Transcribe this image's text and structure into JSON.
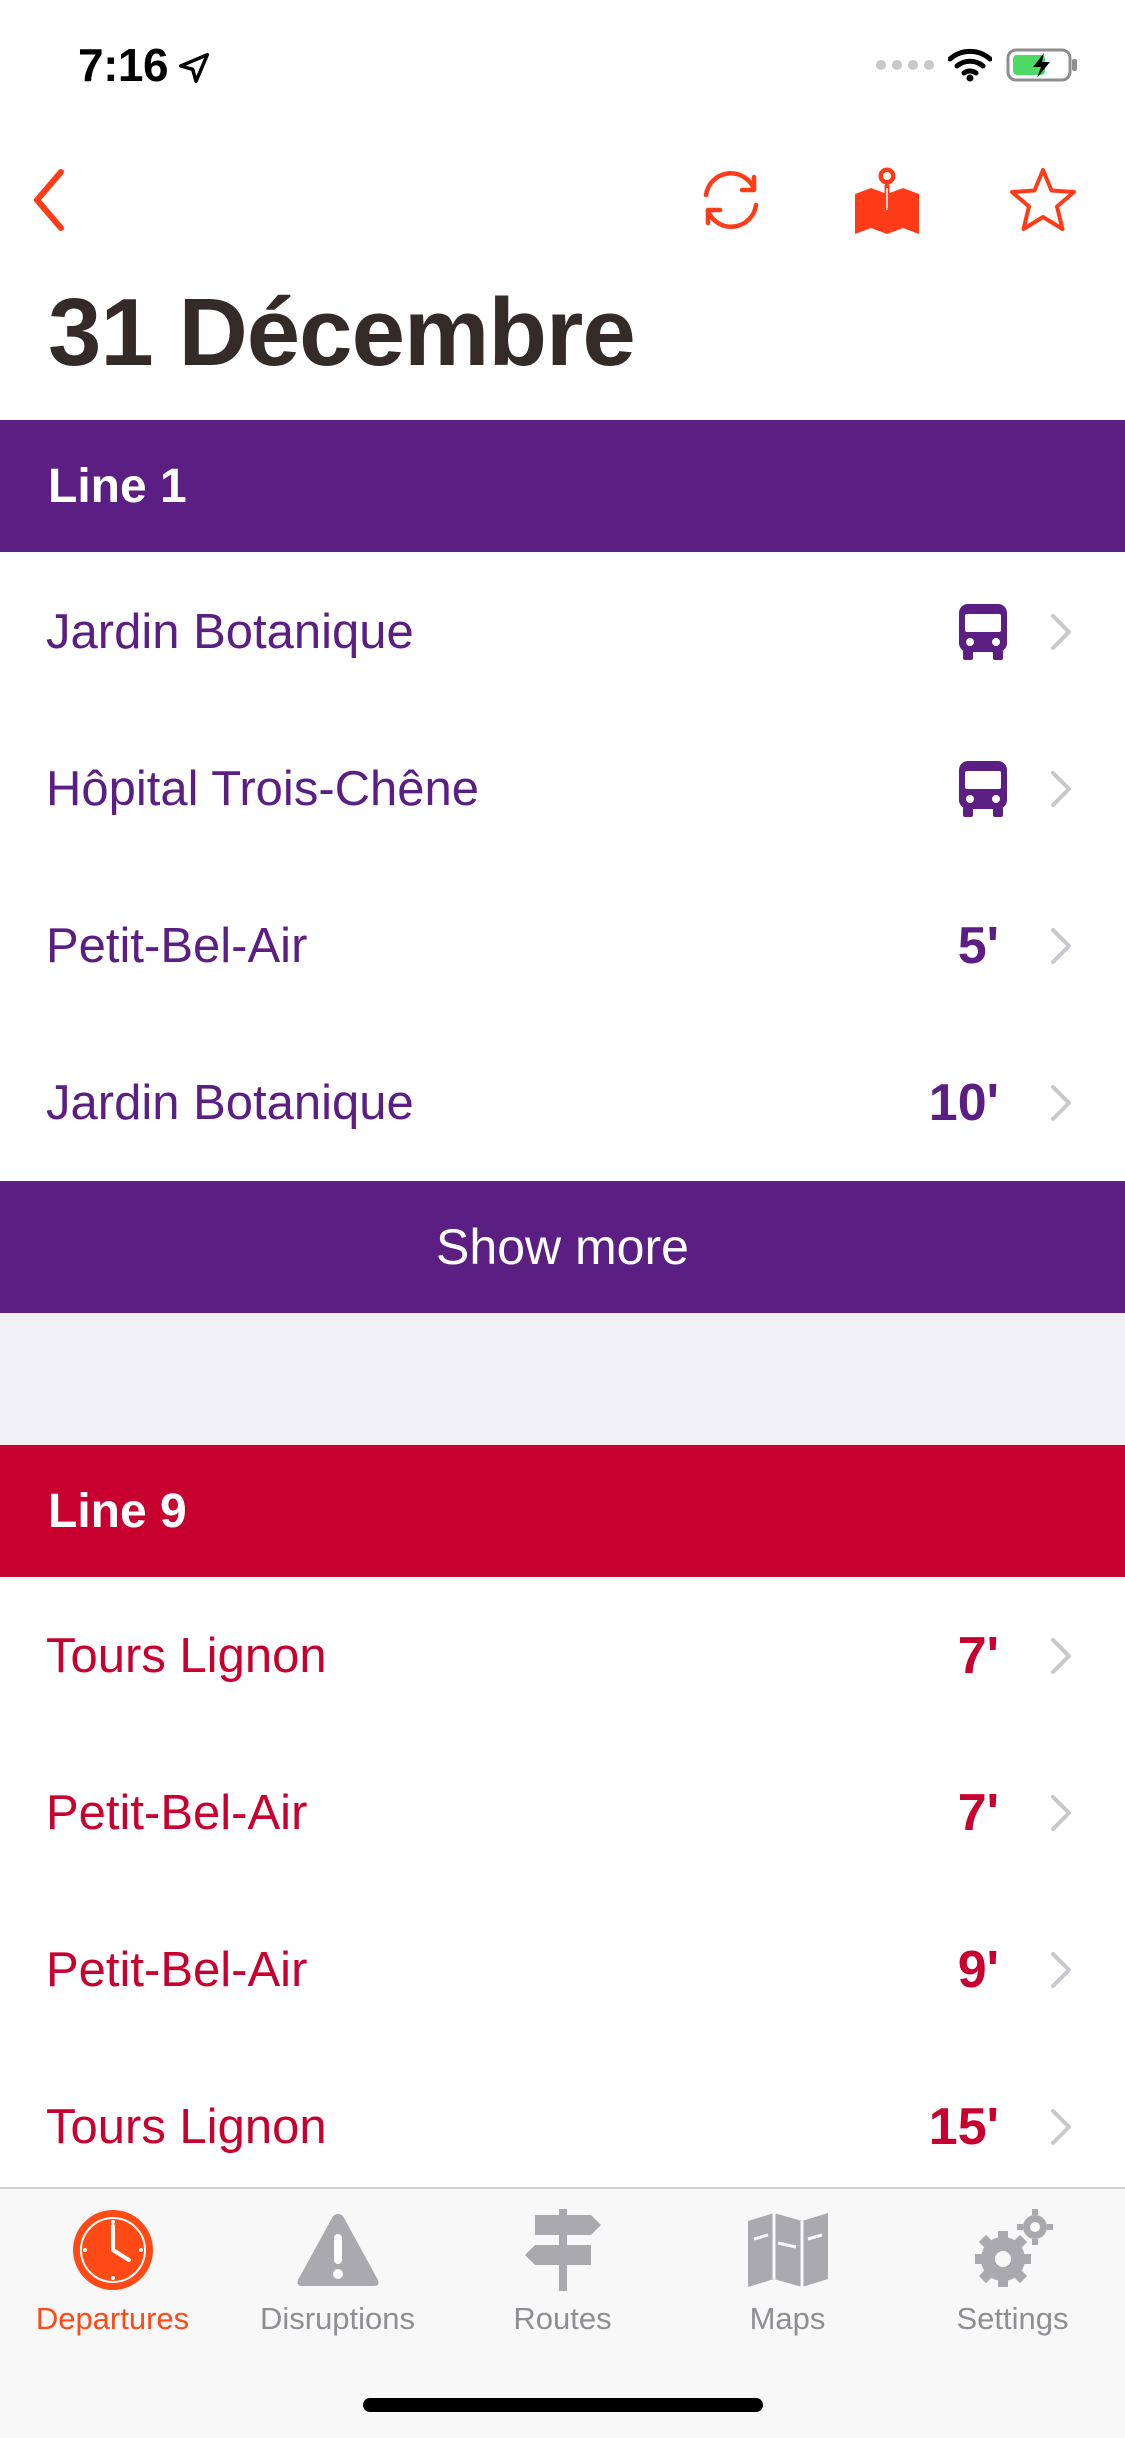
{
  "status_bar": {
    "time": "7:16"
  },
  "title": "31 Décembre",
  "sections": [
    {
      "line": "Line 1",
      "color": "#5b1e82",
      "rows": [
        {
          "destination": "Jardin Botanique",
          "departure": "",
          "icon": "bus-icon"
        },
        {
          "destination": "Hôpital Trois-Chêne",
          "departure": "",
          "icon": "bus-icon"
        },
        {
          "destination": "Petit-Bel-Air",
          "departure": "5'"
        },
        {
          "destination": "Jardin Botanique",
          "departure": "10'"
        }
      ],
      "show_more_label": "Show more"
    },
    {
      "line": "Line 9",
      "color": "#c8002f",
      "rows": [
        {
          "destination": "Tours Lignon",
          "departure": "7'"
        },
        {
          "destination": "Petit-Bel-Air",
          "departure": "7'"
        },
        {
          "destination": "Petit-Bel-Air",
          "departure": "9'"
        },
        {
          "destination": "Tours Lignon",
          "departure": "15'"
        }
      ]
    }
  ],
  "nav_icons": [
    "back-chevron-icon",
    "refresh-icon",
    "map-pin-icon",
    "star-icon"
  ],
  "tabs": [
    {
      "label": "Departures",
      "icon": "clock-icon",
      "active": true
    },
    {
      "label": "Disruptions",
      "icon": "warning-icon",
      "active": false
    },
    {
      "label": "Routes",
      "icon": "signpost-icon",
      "active": false
    },
    {
      "label": "Maps",
      "icon": "map-icon",
      "active": false
    },
    {
      "label": "Settings",
      "icon": "gear-icon",
      "active": false
    }
  ],
  "colors": {
    "accent": "#ff4a15",
    "line1": "#5b1e82",
    "line9": "#c8002f",
    "title": "#342b29",
    "inactive_tab": "#8e8e93"
  }
}
